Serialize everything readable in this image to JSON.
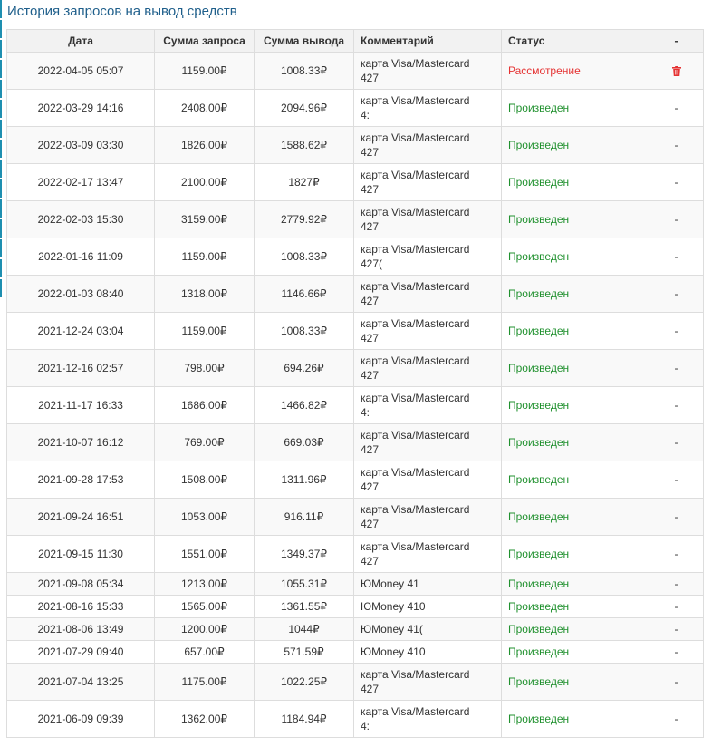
{
  "title": "История запросов на вывод средств",
  "columns": [
    "Дата",
    "Сумма запроса",
    "Сумма вывода",
    "Комментарий",
    "Статус",
    "-"
  ],
  "rows": [
    {
      "date": "2022-04-05 05:07",
      "request": "1159.00₽",
      "payout": "1008.33₽",
      "comment_line1": "карта Visa/Mastercard",
      "comment_line2": "427",
      "status": "Рассмотрение",
      "status_kind": "review",
      "action": ""
    },
    {
      "date": "2022-03-29 14:16",
      "request": "2408.00₽",
      "payout": "2094.96₽",
      "comment_line1": "карта Visa/Mastercard",
      "comment_line2": "4:",
      "status": "Произведен",
      "status_kind": "done",
      "action": "-"
    },
    {
      "date": "2022-03-09 03:30",
      "request": "1826.00₽",
      "payout": "1588.62₽",
      "comment_line1": "карта Visa/Mastercard",
      "comment_line2": "427",
      "status": "Произведен",
      "status_kind": "done",
      "action": "-"
    },
    {
      "date": "2022-02-17 13:47",
      "request": "2100.00₽",
      "payout": "1827₽",
      "comment_line1": "карта Visa/Mastercard",
      "comment_line2": "427",
      "status": "Произведен",
      "status_kind": "done",
      "action": "-"
    },
    {
      "date": "2022-02-03 15:30",
      "request": "3159.00₽",
      "payout": "2779.92₽",
      "comment_line1": "карта Visa/Mastercard",
      "comment_line2": "427",
      "status": "Произведен",
      "status_kind": "done",
      "action": "-"
    },
    {
      "date": "2022-01-16 11:09",
      "request": "1159.00₽",
      "payout": "1008.33₽",
      "comment_line1": "карта Visa/Mastercard",
      "comment_line2": "427(",
      "status": "Произведен",
      "status_kind": "done",
      "action": "-"
    },
    {
      "date": "2022-01-03 08:40",
      "request": "1318.00₽",
      "payout": "1146.66₽",
      "comment_line1": "карта Visa/Mastercard",
      "comment_line2": "427",
      "status": "Произведен",
      "status_kind": "done",
      "action": "-"
    },
    {
      "date": "2021-12-24 03:04",
      "request": "1159.00₽",
      "payout": "1008.33₽",
      "comment_line1": "карта Visa/Mastercard",
      "comment_line2": "427",
      "status": "Произведен",
      "status_kind": "done",
      "action": "-"
    },
    {
      "date": "2021-12-16 02:57",
      "request": "798.00₽",
      "payout": "694.26₽",
      "comment_line1": "карта Visa/Mastercard",
      "comment_line2": "427",
      "status": "Произведен",
      "status_kind": "done",
      "action": "-"
    },
    {
      "date": "2021-11-17 16:33",
      "request": "1686.00₽",
      "payout": "1466.82₽",
      "comment_line1": "карта Visa/Mastercard",
      "comment_line2": "4:",
      "status": "Произведен",
      "status_kind": "done",
      "action": "-"
    },
    {
      "date": "2021-10-07 16:12",
      "request": "769.00₽",
      "payout": "669.03₽",
      "comment_line1": "карта Visa/Mastercard",
      "comment_line2": "427",
      "status": "Произведен",
      "status_kind": "done",
      "action": "-"
    },
    {
      "date": "2021-09-28 17:53",
      "request": "1508.00₽",
      "payout": "1311.96₽",
      "comment_line1": "карта Visa/Mastercard",
      "comment_line2": "427",
      "status": "Произведен",
      "status_kind": "done",
      "action": "-"
    },
    {
      "date": "2021-09-24 16:51",
      "request": "1053.00₽",
      "payout": "916.11₽",
      "comment_line1": "карта Visa/Mastercard",
      "comment_line2": "427",
      "status": "Произведен",
      "status_kind": "done",
      "action": "-"
    },
    {
      "date": "2021-09-15 11:30",
      "request": "1551.00₽",
      "payout": "1349.37₽",
      "comment_line1": "карта Visa/Mastercard",
      "comment_line2": "427",
      "status": "Произведен",
      "status_kind": "done",
      "action": "-"
    },
    {
      "date": "2021-09-08 05:34",
      "request": "1213.00₽",
      "payout": "1055.31₽",
      "comment_line1": "ЮMoney 41",
      "comment_line2": "",
      "status": "Произведен",
      "status_kind": "done",
      "action": "-"
    },
    {
      "date": "2021-08-16 15:33",
      "request": "1565.00₽",
      "payout": "1361.55₽",
      "comment_line1": "ЮMoney 410",
      "comment_line2": "",
      "status": "Произведен",
      "status_kind": "done",
      "action": "-"
    },
    {
      "date": "2021-08-06 13:49",
      "request": "1200.00₽",
      "payout": "1044₽",
      "comment_line1": "ЮMoney 41(",
      "comment_line2": "",
      "status": "Произведен",
      "status_kind": "done",
      "action": "-"
    },
    {
      "date": "2021-07-29 09:40",
      "request": "657.00₽",
      "payout": "571.59₽",
      "comment_line1": "ЮMoney 410",
      "comment_line2": "",
      "status": "Произведен",
      "status_kind": "done",
      "action": "-"
    },
    {
      "date": "2021-07-04 13:25",
      "request": "1175.00₽",
      "payout": "1022.25₽",
      "comment_line1": "карта Visa/Mastercard",
      "comment_line2": "427",
      "status": "Произведен",
      "status_kind": "done",
      "action": "-"
    },
    {
      "date": "2021-06-09 09:39",
      "request": "1362.00₽",
      "payout": "1184.94₽",
      "comment_line1": "карта Visa/Mastercard",
      "comment_line2": "4:",
      "status": "Произведен",
      "status_kind": "done",
      "action": "-"
    }
  ],
  "colors": {
    "title": "#1f5f8b",
    "status_done": "#21912f",
    "status_review": "#e53232",
    "header_bg": "#f2f2f2"
  },
  "icons": {
    "delete": "trash-icon"
  }
}
